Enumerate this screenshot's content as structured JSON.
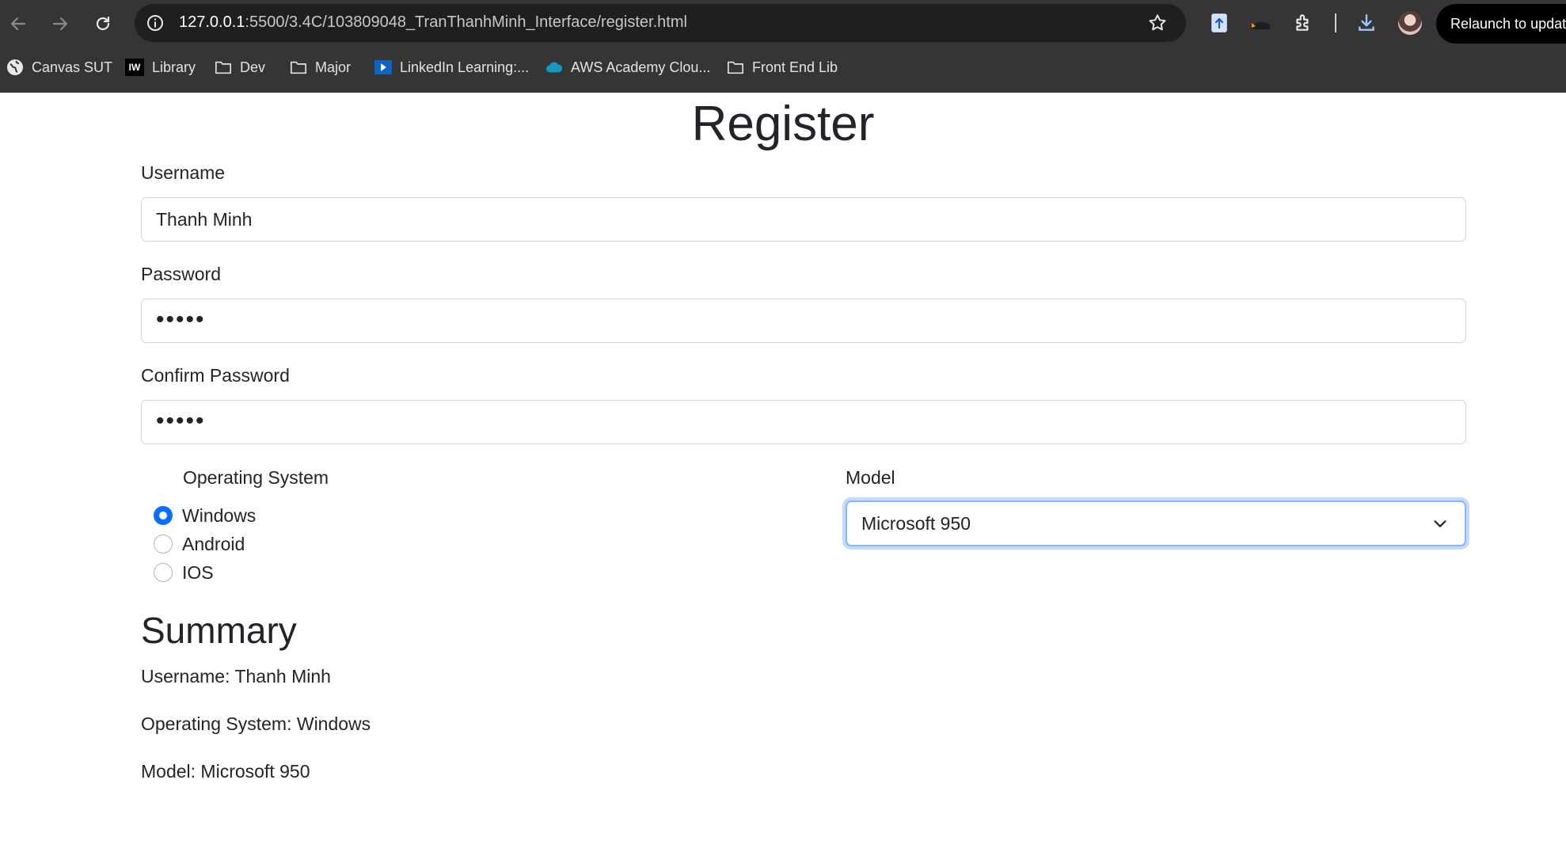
{
  "browser": {
    "url_host": "127.0.0.1",
    "url_rest": ":5500/3.4C/103809048_TranThanhMinh_Interface/register.html",
    "relaunch_label": "Relaunch to update",
    "bookmarks": [
      {
        "label": "Canvas SUT",
        "icon": "globe-icon"
      },
      {
        "label": "Library",
        "icon": "iw-logo-icon"
      },
      {
        "label": "Dev",
        "icon": "folder-icon"
      },
      {
        "label": "Major",
        "icon": "folder-icon"
      },
      {
        "label": "LinkedIn Learning:...",
        "icon": "play-icon"
      },
      {
        "label": "AWS Academy Clou...",
        "icon": "cloud-icon"
      },
      {
        "label": "Front End Lib",
        "icon": "folder-icon"
      }
    ]
  },
  "form": {
    "title": "Register",
    "username_label": "Username",
    "username_value": "Thanh Minh",
    "password_label": "Password",
    "password_value": "•••••",
    "confirm_label": "Confirm Password",
    "confirm_value": "•••••",
    "os_label": "Operating System",
    "os_options": [
      "Windows",
      "Android",
      "IOS"
    ],
    "os_selected": "Windows",
    "model_label": "Model",
    "model_value": "Microsoft 950"
  },
  "summary": {
    "title": "Summary",
    "username_line": "Username: Thanh Minh",
    "os_line": "Operating System: Windows",
    "model_line": "Model: Microsoft 950"
  },
  "colors": {
    "accent": "#0d6efd",
    "chrome_bg": "#353535",
    "omnibox_bg": "#1f1f1f"
  }
}
